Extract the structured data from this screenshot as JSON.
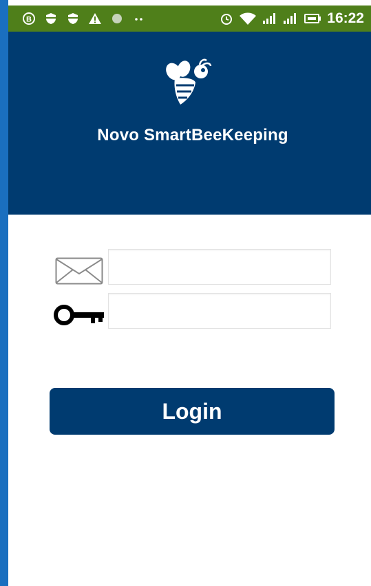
{
  "status_bar": {
    "time": "16:22",
    "icons": [
      "b-circle-icon",
      "shield-icon",
      "shield-icon",
      "warning-icon",
      "circle-icon",
      "dots-icon",
      "alarm-icon",
      "wifi-icon",
      "signal-icon",
      "signal-icon",
      "battery-icon"
    ],
    "background": "#4f7f1a"
  },
  "header": {
    "logo": "bee-icon",
    "title": "Novo SmartBeeKeeping",
    "background": "#003b70"
  },
  "login_form": {
    "email_icon": "envelope-icon",
    "email_value": "",
    "password_icon": "key-icon",
    "password_value": "",
    "login_label": "Login",
    "button_color": "#003b70"
  }
}
